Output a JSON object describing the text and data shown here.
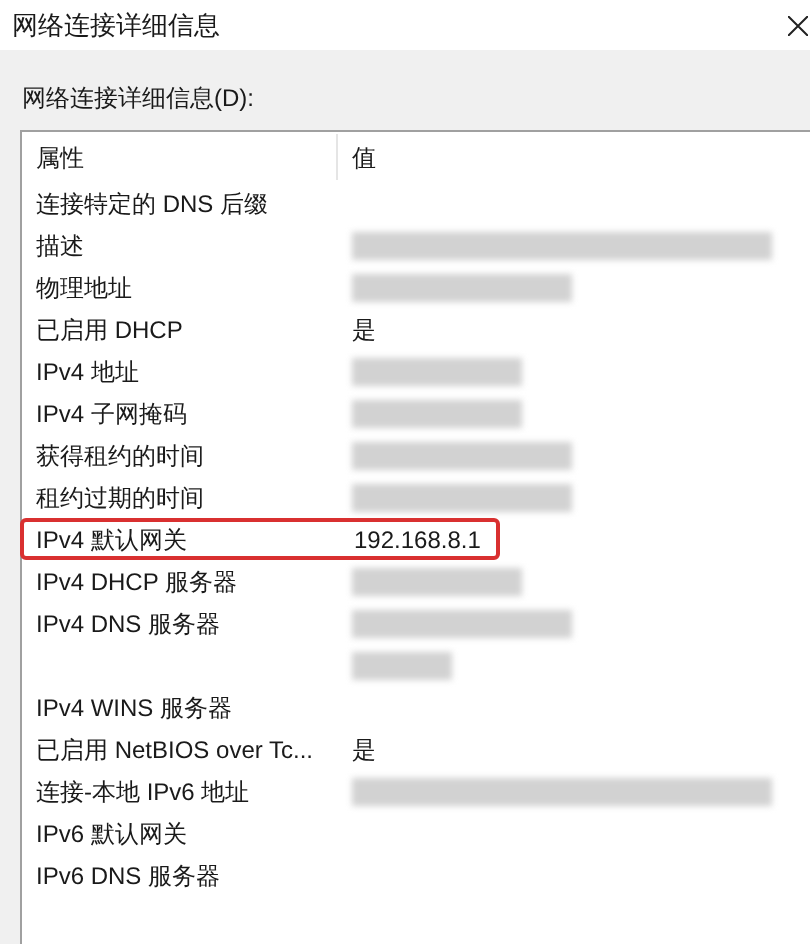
{
  "window": {
    "title": "网络连接详细信息"
  },
  "list_label": "网络连接详细信息(D):",
  "table": {
    "columns": [
      "属性",
      "值"
    ],
    "rows": [
      {
        "property": "连接特定的 DNS 后缀",
        "kind": "text",
        "value": "",
        "highlighted": false
      },
      {
        "property": "描述",
        "kind": "blurred_long",
        "highlighted": false
      },
      {
        "property": "物理地址",
        "kind": "blurred_medium",
        "highlighted": false
      },
      {
        "property": "已启用 DHCP",
        "kind": "text",
        "value": "是",
        "highlighted": false
      },
      {
        "property": "IPv4 地址",
        "kind": "blurred_short",
        "highlighted": false
      },
      {
        "property": "IPv4 子网掩码",
        "kind": "blurred_short",
        "highlighted": false
      },
      {
        "property": "获得租约的时间",
        "kind": "blurred_medium",
        "highlighted": false
      },
      {
        "property": "租约过期的时间",
        "kind": "blurred_medium",
        "highlighted": false
      },
      {
        "property": "IPv4 默认网关",
        "kind": "text",
        "value": "192.168.8.1",
        "highlighted": true
      },
      {
        "property": "IPv4 DHCP 服务器",
        "kind": "blurred_short",
        "highlighted": false
      },
      {
        "property": "IPv4 DNS 服务器",
        "kind": "blurred_medium",
        "highlighted": false
      },
      {
        "property": "",
        "kind": "blurred_tiny",
        "highlighted": false
      },
      {
        "property": "IPv4 WINS 服务器",
        "kind": "text",
        "value": "",
        "highlighted": false
      },
      {
        "property": "已启用 NetBIOS over Tc...",
        "kind": "text",
        "value": "是",
        "highlighted": false
      },
      {
        "property": "连接-本地 IPv6 地址",
        "kind": "blurred_long",
        "highlighted": false
      },
      {
        "property": "IPv6 默认网关",
        "kind": "text",
        "value": "",
        "highlighted": false
      },
      {
        "property": "IPv6 DNS 服务器",
        "kind": "text",
        "value": "",
        "highlighted": false
      }
    ]
  }
}
